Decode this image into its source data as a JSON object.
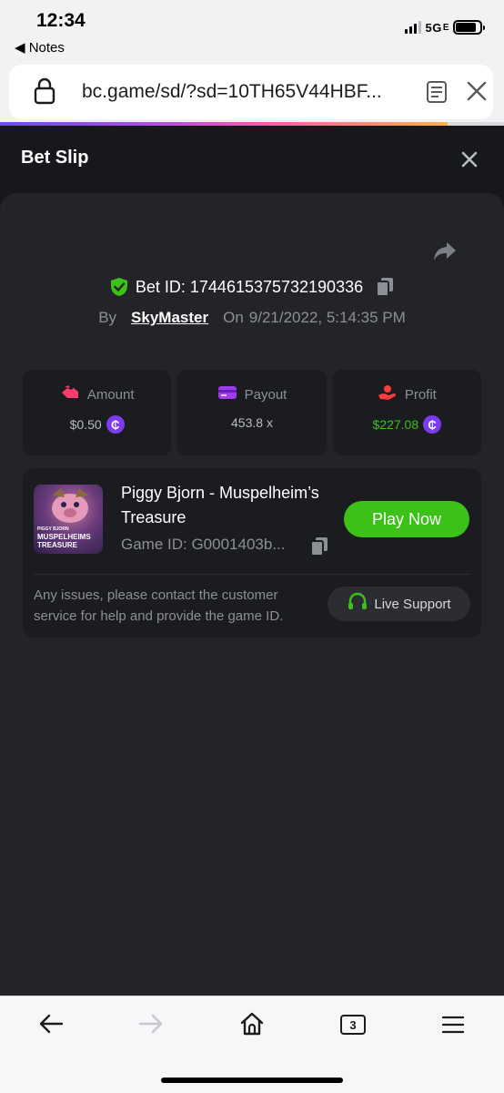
{
  "status_bar": {
    "time": "12:34",
    "back_label": "◀ Notes",
    "network": "5G",
    "network_suffix": "E"
  },
  "browser": {
    "url": "bc.game/sd/?sd=10TH65V44HBF...",
    "tab_count": "3"
  },
  "slip": {
    "title": "Bet Slip",
    "bet_id": "Bet ID: 1744615375732190336",
    "by_label": "By",
    "user": "SkyMaster",
    "on_label": "On",
    "date": "9/21/2022, 5:14:35 PM"
  },
  "stats": {
    "amount": {
      "label": "Amount",
      "value": "$0.50"
    },
    "payout": {
      "label": "Payout",
      "value": "453.8 x"
    },
    "profit": {
      "label": "Profit",
      "value": "$227.08"
    },
    "coin_symbol": "₵"
  },
  "game": {
    "name": "Piggy Bjorn - Muspelheim’s Treasure",
    "id": "Game ID: G0001403b...",
    "thumb_small": "PIGGY BJORN",
    "thumb_big": "MUSPELHEIMS TREASURE",
    "play_label": "Play Now",
    "support_text": "Any issues, please contact the customer service for help and provide the game ID.",
    "support_label": "Live Support"
  },
  "colors": {
    "accent_green": "#3bc117",
    "coin_purple": "#7b3cf0",
    "panel": "#232428"
  }
}
